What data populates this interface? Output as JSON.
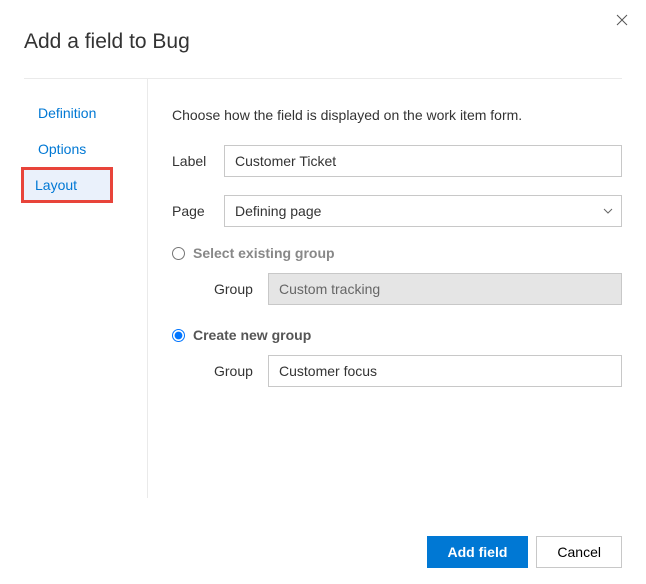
{
  "title": "Add a field to Bug",
  "sidebar": {
    "items": [
      {
        "label": "Definition"
      },
      {
        "label": "Options"
      },
      {
        "label": "Layout"
      }
    ]
  },
  "main": {
    "instruction": "Choose how the field is displayed on the work item form.",
    "label_field": {
      "label": "Label",
      "value": "Customer Ticket"
    },
    "page_field": {
      "label": "Page",
      "value": "Defining page"
    },
    "existing_group": {
      "radio_label": "Select existing group",
      "group_label": "Group",
      "group_value": "Custom tracking"
    },
    "new_group": {
      "radio_label": "Create new group",
      "group_label": "Group",
      "group_value": "Customer focus"
    }
  },
  "footer": {
    "primary": "Add field",
    "cancel": "Cancel"
  }
}
